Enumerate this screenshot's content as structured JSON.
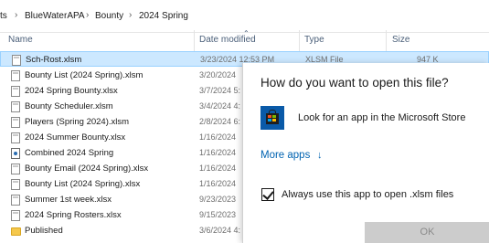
{
  "breadcrumb": {
    "items": [
      "ts",
      "BlueWaterAPA",
      "Bounty",
      "2024 Spring"
    ],
    "separator": "›"
  },
  "columns": {
    "name": "Name",
    "date_modified": "Date modified",
    "type": "Type",
    "size": "Size"
  },
  "files": [
    {
      "name": "Sch-Rost.xlsm",
      "date": "3/23/2024 12:53 PM",
      "type": "XLSM File",
      "size": "947 K",
      "icon": "excel-file-icon"
    },
    {
      "name": "Bounty List (2024 Spring).xlsm",
      "date": "3/20/2024",
      "type": "",
      "size": "",
      "icon": "excel-file-icon"
    },
    {
      "name": "2024 Spring Bounty.xlsx",
      "date": "3/7/2024 5:",
      "type": "",
      "size": "",
      "icon": "excel-file-icon"
    },
    {
      "name": "Bounty Scheduler.xlsm",
      "date": "3/4/2024 4:",
      "type": "",
      "size": "",
      "icon": "excel-file-icon"
    },
    {
      "name": "Players (Spring 2024).xlsm",
      "date": "2/8/2024 6:",
      "type": "",
      "size": "",
      "icon": "excel-file-icon"
    },
    {
      "name": "2024 Summer Bounty.xlsx",
      "date": "1/16/2024",
      "type": "",
      "size": "",
      "icon": "excel-file-icon"
    },
    {
      "name": "Combined 2024 Spring",
      "date": "1/16/2024",
      "type": "",
      "size": "",
      "icon": "document-icon"
    },
    {
      "name": "Bounty Email (2024 Spring).xlsx",
      "date": "1/16/2024",
      "type": "",
      "size": "",
      "icon": "excel-file-icon"
    },
    {
      "name": "Bounty List (2024 Spring).xlsx",
      "date": "1/16/2024",
      "type": "",
      "size": "",
      "icon": "excel-file-icon"
    },
    {
      "name": "Summer 1st week.xlsx",
      "date": "9/23/2023",
      "type": "",
      "size": "",
      "icon": "excel-file-icon"
    },
    {
      "name": "2024 Spring Rosters.xlsx",
      "date": "9/15/2023",
      "type": "",
      "size": "",
      "icon": "excel-file-icon"
    },
    {
      "name": "Published",
      "date": "3/6/2024 4:",
      "type": "",
      "size": "",
      "icon": "folder-icon"
    }
  ],
  "dialog": {
    "title": "How do you want to open this file?",
    "store_option": "Look for an app in the Microsoft Store",
    "more_apps": "More apps",
    "more_apps_arrow": "↓",
    "always_use": "Always use this app to open .xlsm files",
    "always_use_checked": true,
    "ok_label": "OK"
  },
  "colors": {
    "selection": "#cce8ff",
    "link": "#0063b1",
    "store_blue": "#0a5aa8"
  }
}
